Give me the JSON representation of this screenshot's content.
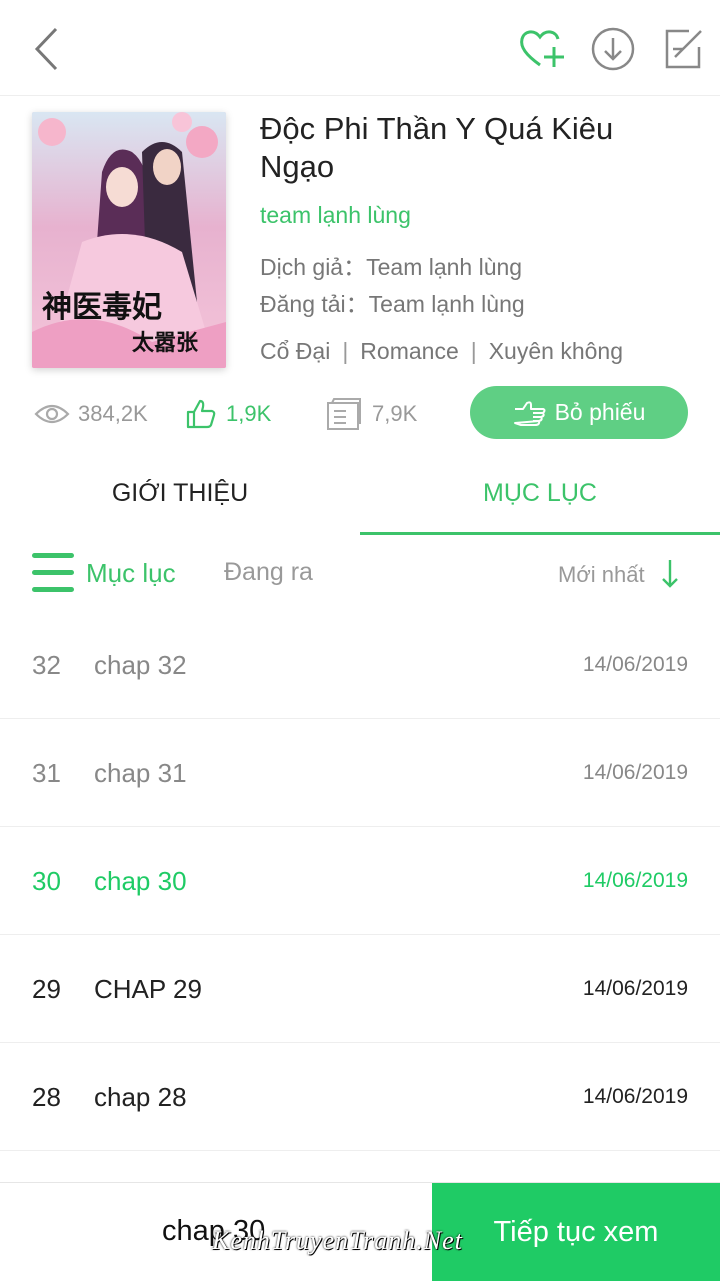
{
  "header": {
    "back_icon": "back-arrow-icon",
    "actions": [
      "heart-plus-icon",
      "download-icon",
      "edit-icon"
    ]
  },
  "book": {
    "title": "Độc Phi Thần Y Quá Kiêu Ngạo",
    "team": "team lạnh lùng",
    "translator_label": "Dịch giả：",
    "translator": "Team lạnh lùng",
    "uploader_label": "Đăng tải：",
    "uploader": "Team lạnh lùng",
    "tags": [
      "Cổ Đại",
      "Romance",
      "Xuyên không"
    ],
    "cover_text": "神医毒妃太嚣张"
  },
  "stats": {
    "views": "384,2K",
    "likes": "1,9K",
    "tickets": "7,9K",
    "vote_label": "Bỏ phiếu"
  },
  "tabs": [
    {
      "label": "GIỚI THIỆU",
      "active": false
    },
    {
      "label": "MỤC LỤC",
      "active": true
    }
  ],
  "toc": {
    "label": "Mục lục",
    "status": "Đang ra",
    "sort_label": "Mới nhất"
  },
  "chapters": [
    {
      "num": "32",
      "name": "chap 32",
      "date": "14/06/2019",
      "state": "read"
    },
    {
      "num": "31",
      "name": "chap 31",
      "date": "14/06/2019",
      "state": "read"
    },
    {
      "num": "30",
      "name": "chap 30",
      "date": "14/06/2019",
      "state": "current"
    },
    {
      "num": "29",
      "name": "CHAP 29",
      "date": "14/06/2019",
      "state": "unread"
    },
    {
      "num": "28",
      "name": "chap 28",
      "date": "14/06/2019",
      "state": "unread"
    }
  ],
  "bottom": {
    "current_chapter": "chap 30",
    "continue_label": "Tiếp tục xem",
    "watermark": "KenhTruyenTranh.Net"
  },
  "colors": {
    "accent": "#3cc36a",
    "button": "#5fcf84",
    "continue": "#1fcb65",
    "read_text": "#888888"
  }
}
